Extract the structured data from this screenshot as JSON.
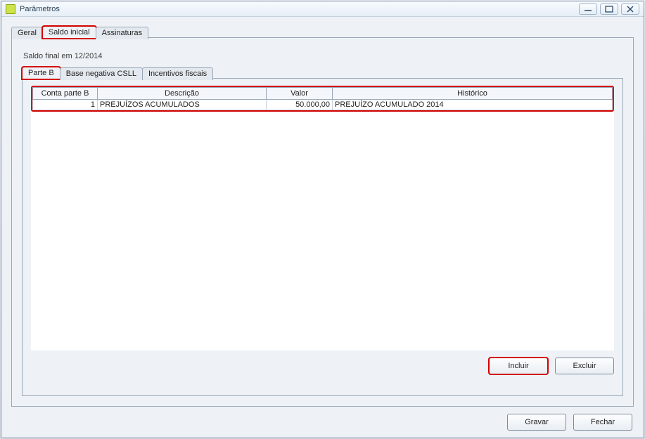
{
  "window": {
    "title": "Parâmetros"
  },
  "tabs": {
    "items": [
      {
        "label": "Geral",
        "active": false
      },
      {
        "label": "Saldo inicial",
        "active": true
      },
      {
        "label": "Assinaturas",
        "active": false
      }
    ]
  },
  "section_label": "Saldo final em 12/2014",
  "inner_tabs": {
    "items": [
      {
        "label": "Parte B",
        "active": true
      },
      {
        "label": "Base negativa CSLL",
        "active": false
      },
      {
        "label": "Incentivos fiscais",
        "active": false
      }
    ]
  },
  "table": {
    "headers": {
      "conta": "Conta parte B",
      "descricao": "Descrição",
      "valor": "Valor",
      "historico": "Histórico"
    },
    "rows": [
      {
        "conta": "1",
        "descricao": "PREJUÍZOS ACUMULADOS",
        "valor": "50.000,00",
        "historico": "PREJUÍZO ACUMULADO 2014"
      }
    ]
  },
  "buttons": {
    "incluir": "Incluir",
    "excluir": "Excluir",
    "gravar": "Gravar",
    "fechar": "Fechar"
  }
}
